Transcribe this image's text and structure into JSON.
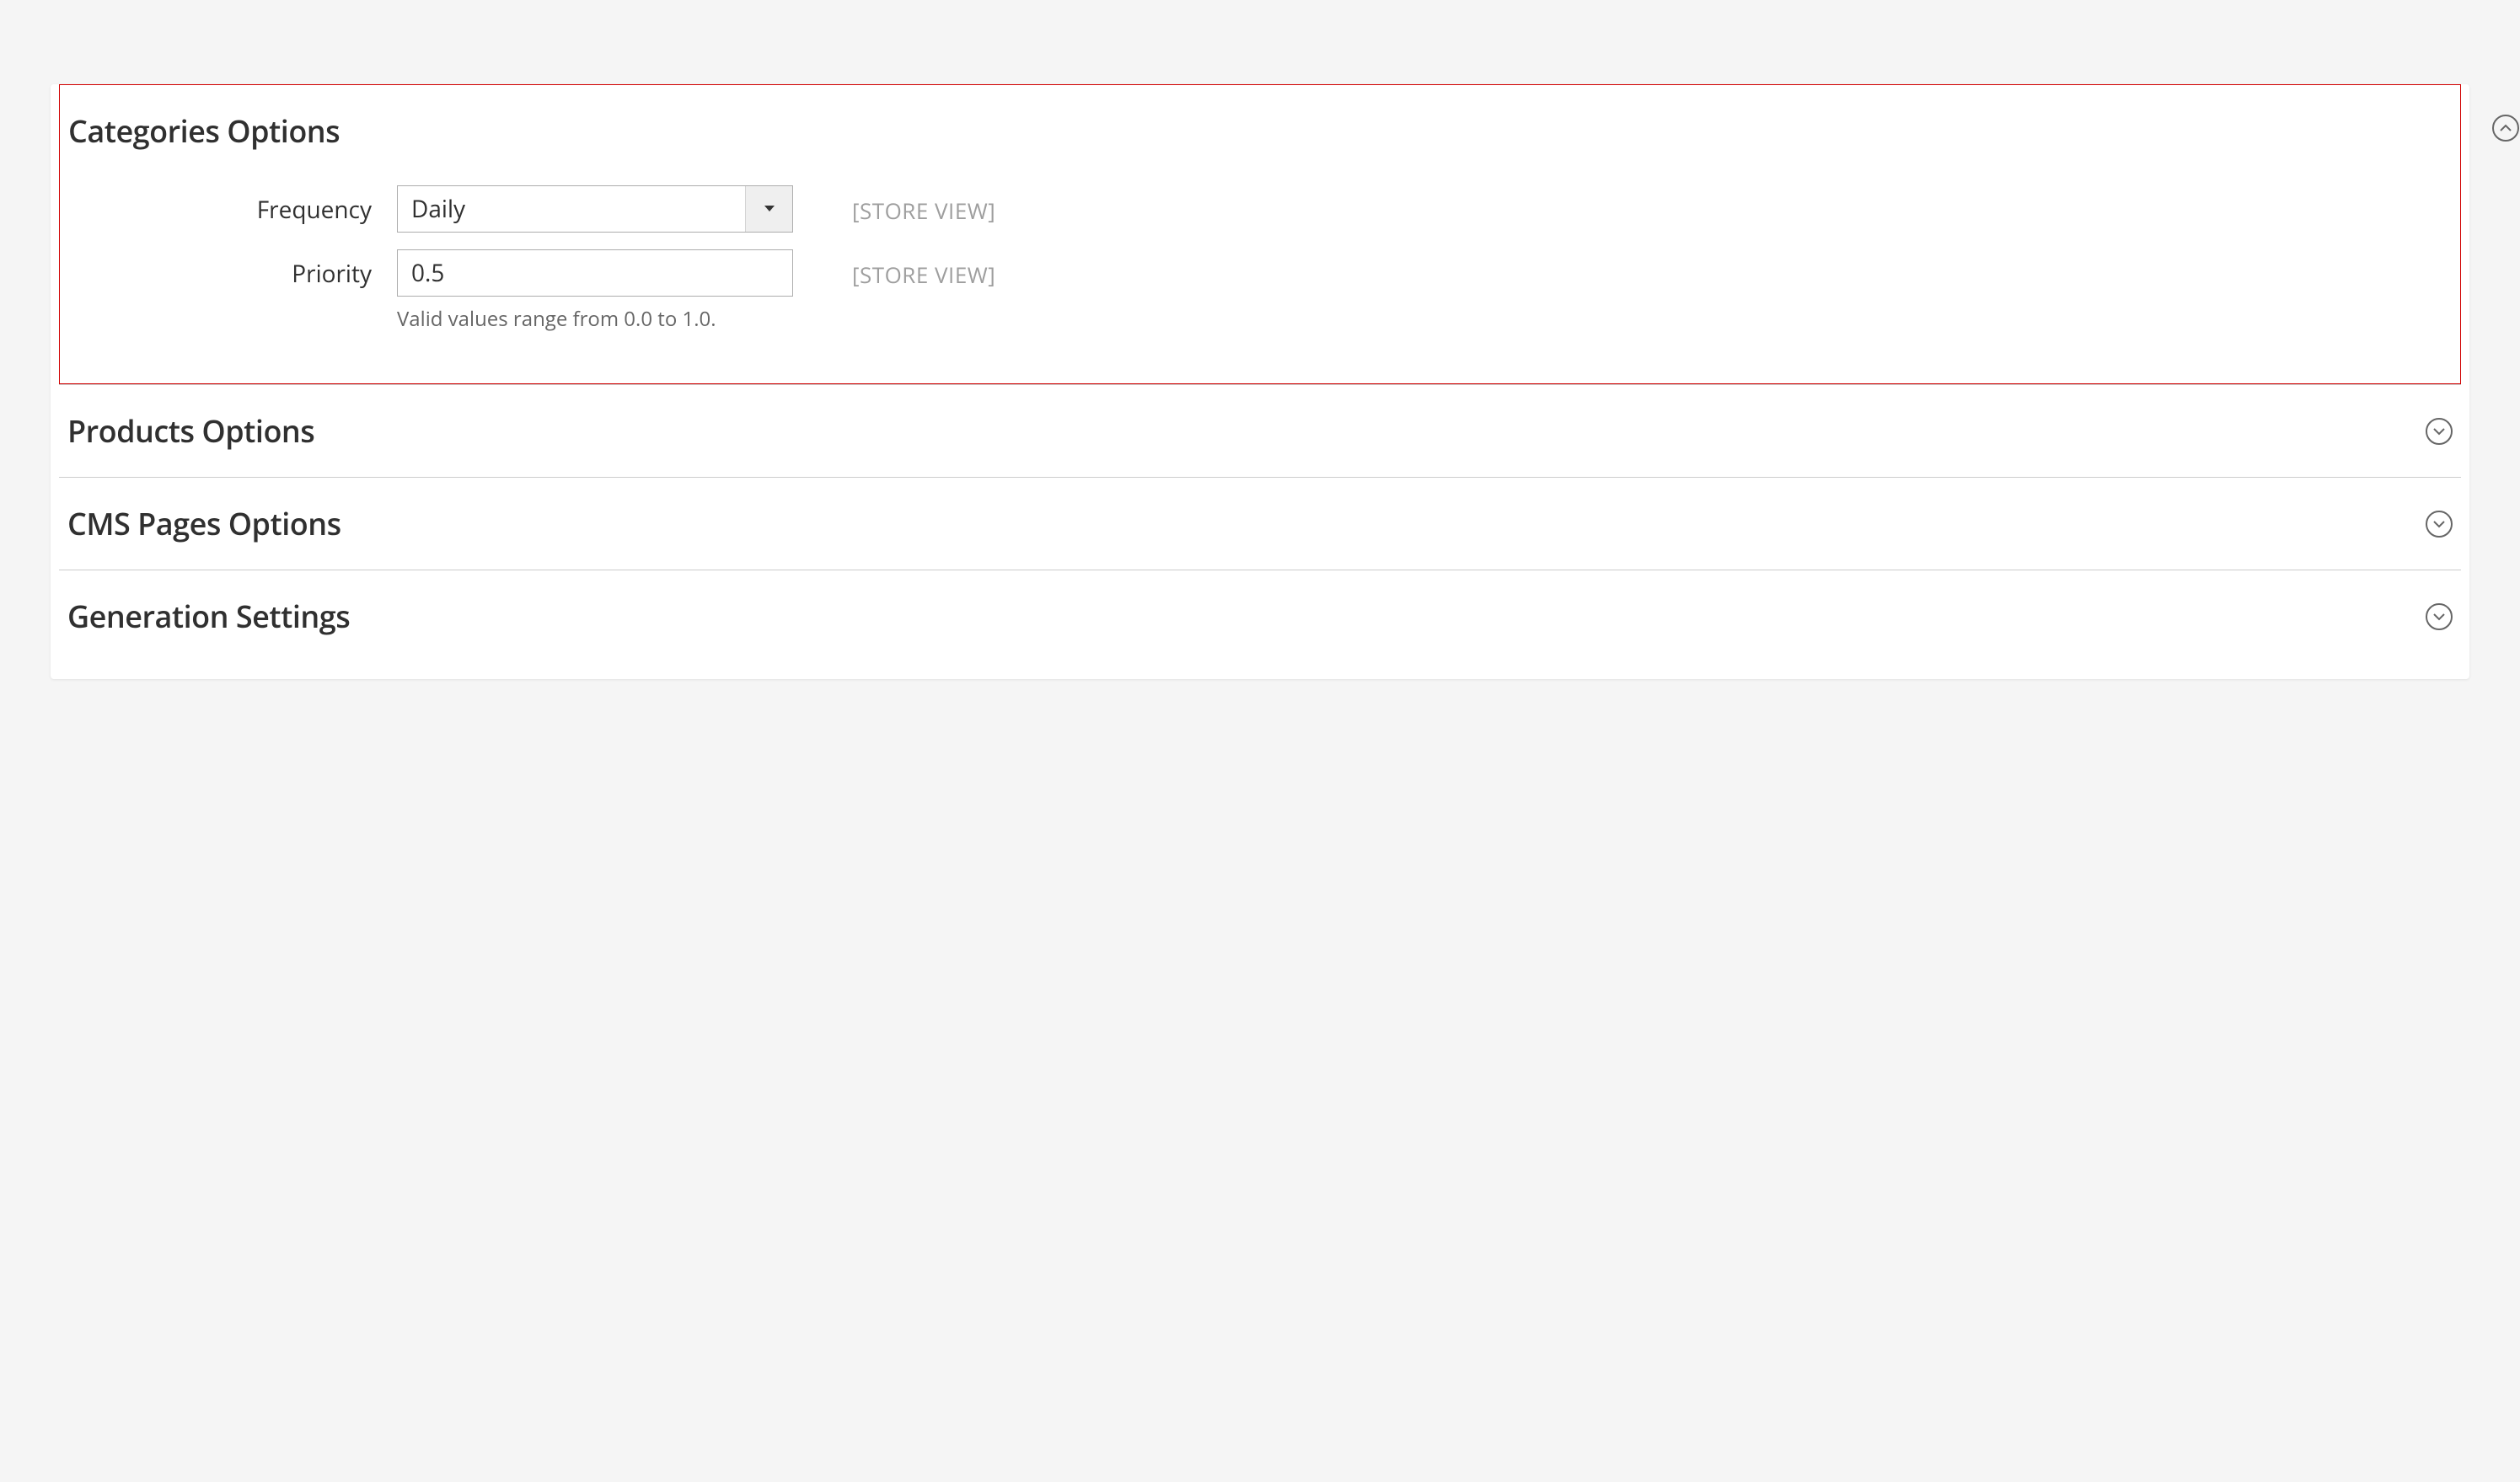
{
  "sections": {
    "categories": {
      "title": "Categories Options",
      "expanded": true,
      "fields": {
        "frequency": {
          "label": "Frequency",
          "value": "Daily",
          "scope": "[STORE VIEW]"
        },
        "priority": {
          "label": "Priority",
          "value": "0.5",
          "hint": "Valid values range from 0.0 to 1.0.",
          "scope": "[STORE VIEW]"
        }
      }
    },
    "products": {
      "title": "Products Options",
      "expanded": false
    },
    "cms_pages": {
      "title": "CMS Pages Options",
      "expanded": false
    },
    "generation": {
      "title": "Generation Settings",
      "expanded": false
    }
  }
}
